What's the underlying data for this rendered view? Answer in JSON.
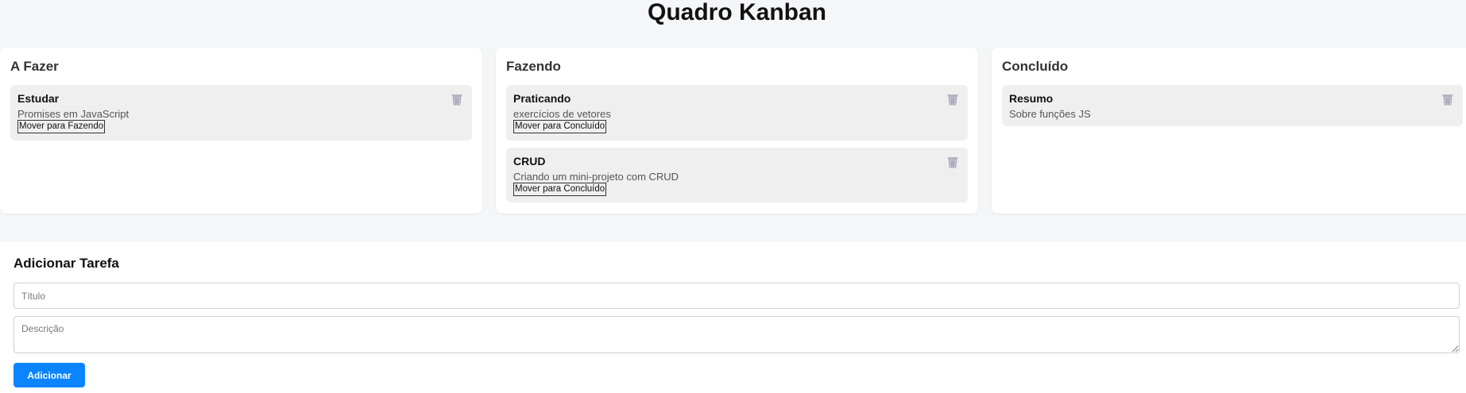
{
  "page": {
    "title": "Quadro Kanban"
  },
  "columns": [
    {
      "title": "A Fazer",
      "cards": [
        {
          "title": "Estudar",
          "description": "Promises em JavaScript",
          "move_label": "Mover para Fazendo"
        }
      ]
    },
    {
      "title": "Fazendo",
      "cards": [
        {
          "title": "Praticando",
          "description": "exercícios de vetores",
          "move_label": "Mover para Concluído"
        },
        {
          "title": "CRUD",
          "description": "Criando um mini-projeto com CRUD",
          "move_label": "Mover para Concluído"
        }
      ]
    },
    {
      "title": "Concluído",
      "cards": [
        {
          "title": "Resumo",
          "description": "Sobre funções JS"
        }
      ]
    }
  ],
  "form": {
    "title": "Adicionar Tarefa",
    "title_placeholder": "Título",
    "title_value": "",
    "description_placeholder": "Descrição",
    "description_value": "",
    "submit_label": "Adicionar"
  },
  "icons": {
    "delete": "trash-icon"
  },
  "colors": {
    "page_background": "#f5f6f8",
    "card_background": "#efefef",
    "primary_button": "#0a84ff",
    "trash_icon": "#a8a8b8"
  }
}
